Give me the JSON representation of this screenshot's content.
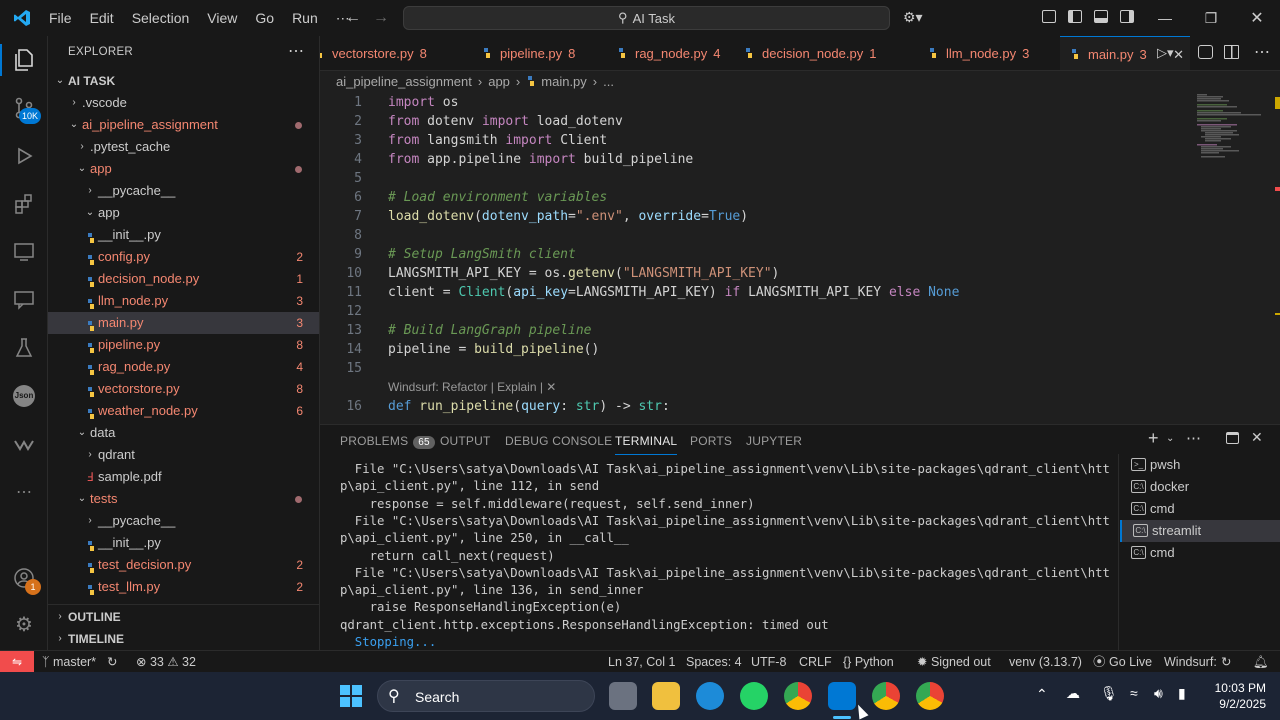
{
  "titlebar": {
    "menu": [
      "File",
      "Edit",
      "Selection",
      "View",
      "Go",
      "Run",
      "⋯"
    ],
    "search_text": "AI Task"
  },
  "activity": {
    "scm_badge": "10K",
    "account_badge": "1"
  },
  "explorer": {
    "header": "EXPLORER",
    "root": "AI TASK",
    "outline": "OUTLINE",
    "timeline": "TIMELINE",
    "rows": [
      {
        "label": ".vscode",
        "depth": 1,
        "kind": "folder-closed",
        "color": "norm",
        "count": ""
      },
      {
        "label": "ai_pipeline_assignment",
        "depth": 1,
        "kind": "folder-open",
        "color": "err",
        "count": "",
        "dot": true
      },
      {
        "label": ".pytest_cache",
        "depth": 2,
        "kind": "folder-closed",
        "color": "norm",
        "count": ""
      },
      {
        "label": "app",
        "depth": 2,
        "kind": "folder-open",
        "color": "err",
        "count": "",
        "dot": true
      },
      {
        "label": "__pycache__",
        "depth": 3,
        "kind": "folder-closed",
        "color": "norm",
        "count": ""
      },
      {
        "label": "app",
        "depth": 3,
        "kind": "folder-open",
        "color": "norm",
        "count": ""
      },
      {
        "label": "__init__.py",
        "depth": 3,
        "kind": "py",
        "color": "norm",
        "count": ""
      },
      {
        "label": "config.py",
        "depth": 3,
        "kind": "py",
        "color": "err",
        "count": "2"
      },
      {
        "label": "decision_node.py",
        "depth": 3,
        "kind": "py",
        "color": "err",
        "count": "1"
      },
      {
        "label": "llm_node.py",
        "depth": 3,
        "kind": "py",
        "color": "err",
        "count": "3"
      },
      {
        "label": "main.py",
        "depth": 3,
        "kind": "py",
        "color": "err",
        "count": "3",
        "selected": true
      },
      {
        "label": "pipeline.py",
        "depth": 3,
        "kind": "py",
        "color": "err",
        "count": "8"
      },
      {
        "label": "rag_node.py",
        "depth": 3,
        "kind": "py",
        "color": "err",
        "count": "4"
      },
      {
        "label": "vectorstore.py",
        "depth": 3,
        "kind": "py",
        "color": "err",
        "count": "8"
      },
      {
        "label": "weather_node.py",
        "depth": 3,
        "kind": "py",
        "color": "err",
        "count": "6"
      },
      {
        "label": "data",
        "depth": 2,
        "kind": "folder-open",
        "color": "norm",
        "count": ""
      },
      {
        "label": "qdrant",
        "depth": 3,
        "kind": "folder-closed",
        "color": "norm",
        "count": ""
      },
      {
        "label": "sample.pdf",
        "depth": 3,
        "kind": "pdf",
        "color": "norm",
        "count": ""
      },
      {
        "label": "tests",
        "depth": 2,
        "kind": "folder-open",
        "color": "err",
        "count": "",
        "dot": true
      },
      {
        "label": "__pycache__",
        "depth": 3,
        "kind": "folder-closed",
        "color": "norm",
        "count": ""
      },
      {
        "label": "__init__.py",
        "depth": 3,
        "kind": "py",
        "color": "norm",
        "count": ""
      },
      {
        "label": "test_decision.py",
        "depth": 3,
        "kind": "py",
        "color": "err",
        "count": "2"
      },
      {
        "label": "test_llm.py",
        "depth": 3,
        "kind": "py",
        "color": "err",
        "count": "2"
      }
    ]
  },
  "tabs": [
    {
      "name": "vectorstore.py",
      "count": "8"
    },
    {
      "name": "pipeline.py",
      "count": "8"
    },
    {
      "name": "rag_node.py",
      "count": "4"
    },
    {
      "name": "decision_node.py",
      "count": "1"
    },
    {
      "name": "llm_node.py",
      "count": "3"
    },
    {
      "name": "main.py",
      "count": "3",
      "active": true
    }
  ],
  "breadcrumb": [
    "ai_pipeline_assignment",
    "app",
    "main.py",
    "..."
  ],
  "codelens": "Windsurf: Refactor | Explain | ✕",
  "code_lines": [
    {
      "n": "1",
      "tokens": [
        [
          "kw",
          "import"
        ],
        [
          "pl",
          " os"
        ]
      ]
    },
    {
      "n": "2",
      "tokens": [
        [
          "kw",
          "from"
        ],
        [
          "pl",
          " dotenv "
        ],
        [
          "kw",
          "import"
        ],
        [
          "pl",
          " load_dotenv"
        ]
      ]
    },
    {
      "n": "3",
      "tokens": [
        [
          "kw",
          "from"
        ],
        [
          "pl",
          " langsmith "
        ],
        [
          "kw",
          "import"
        ],
        [
          "pl",
          " Client"
        ]
      ]
    },
    {
      "n": "4",
      "tokens": [
        [
          "kw",
          "from"
        ],
        [
          "pl",
          " app.pipeline "
        ],
        [
          "kw",
          "import"
        ],
        [
          "pl",
          " build_pipeline"
        ]
      ]
    },
    {
      "n": "5",
      "tokens": []
    },
    {
      "n": "6",
      "tokens": [
        [
          "cm",
          "# Load environment variables"
        ]
      ]
    },
    {
      "n": "7",
      "tokens": [
        [
          "fn",
          "load_dotenv"
        ],
        [
          "pl",
          "("
        ],
        [
          "var",
          "dotenv_path"
        ],
        [
          "pl",
          "="
        ],
        [
          "str",
          "\".env\""
        ],
        [
          "pl",
          ", "
        ],
        [
          "var",
          "override"
        ],
        [
          "pl",
          "="
        ],
        [
          "cn",
          "True"
        ],
        [
          "pl",
          ")"
        ]
      ]
    },
    {
      "n": "8",
      "tokens": []
    },
    {
      "n": "9",
      "tokens": [
        [
          "cm",
          "# Setup LangSmith client"
        ]
      ]
    },
    {
      "n": "10",
      "tokens": [
        [
          "pl",
          "LANGSMITH_API_KEY = os."
        ],
        [
          "fn",
          "getenv"
        ],
        [
          "pl",
          "("
        ],
        [
          "str",
          "\"LANGSMITH_API_KEY\""
        ],
        [
          "pl",
          ")"
        ]
      ]
    },
    {
      "n": "11",
      "tokens": [
        [
          "pl",
          "client = "
        ],
        [
          "bi",
          "Client"
        ],
        [
          "pl",
          "("
        ],
        [
          "var",
          "api_key"
        ],
        [
          "pl",
          "=LANGSMITH_API_KEY) "
        ],
        [
          "kw",
          "if"
        ],
        [
          "pl",
          " LANGSMITH_API_KEY "
        ],
        [
          "kw",
          "else"
        ],
        [
          "cn",
          " None"
        ]
      ]
    },
    {
      "n": "12",
      "tokens": []
    },
    {
      "n": "13",
      "tokens": [
        [
          "cm",
          "# Build LangGraph pipeline"
        ]
      ]
    },
    {
      "n": "14",
      "tokens": [
        [
          "pl",
          "pipeline = "
        ],
        [
          "fn",
          "build_pipeline"
        ],
        [
          "pl",
          "()"
        ]
      ]
    },
    {
      "n": "15",
      "tokens": []
    },
    {
      "n": "",
      "tokens": [],
      "codelens": true
    },
    {
      "n": "16",
      "tokens": [
        [
          "cn",
          "def"
        ],
        [
          "fn",
          " run_pipeline"
        ],
        [
          "pl",
          "("
        ],
        [
          "var",
          "query"
        ],
        [
          "pl",
          ": "
        ],
        [
          "bi",
          "str"
        ],
        [
          "pl",
          ") -> "
        ],
        [
          "bi",
          "str"
        ],
        [
          "pl",
          ":"
        ]
      ]
    }
  ],
  "panel": {
    "tabs": [
      "PROBLEMS",
      "OUTPUT",
      "DEBUG CONSOLE",
      "TERMINAL",
      "PORTS",
      "JUPYTER"
    ],
    "problems_count": "65",
    "active_tab": "TERMINAL",
    "terminal_lines": [
      "  File \"C:\\Users\\satya\\Downloads\\AI Task\\ai_pipeline_assignment\\venv\\Lib\\site-packages\\qdrant_client\\htt",
      "p\\api_client.py\", line 112, in send",
      "    response = self.middleware(request, self.send_inner)",
      "  File \"C:\\Users\\satya\\Downloads\\AI Task\\ai_pipeline_assignment\\venv\\Lib\\site-packages\\qdrant_client\\htt",
      "p\\api_client.py\", line 250, in __call__",
      "    return call_next(request)",
      "  File \"C:\\Users\\satya\\Downloads\\AI Task\\ai_pipeline_assignment\\venv\\Lib\\site-packages\\qdrant_client\\htt",
      "p\\api_client.py\", line 136, in send_inner",
      "    raise ResponseHandlingException(e)",
      "qdrant_client.http.exceptions.ResponseHandlingException: timed out",
      "  Stopping..."
    ],
    "terminals": [
      {
        "name": "pwsh",
        "icon": ">_"
      },
      {
        "name": "docker",
        "icon": "C:\\"
      },
      {
        "name": "cmd",
        "icon": "C:\\"
      },
      {
        "name": "streamlit",
        "icon": "C:\\",
        "active": true
      },
      {
        "name": "cmd",
        "icon": "C:\\"
      }
    ]
  },
  "status": {
    "branch": "master*",
    "errors": "33",
    "warnings": "32",
    "position": "Ln 37, Col 1",
    "spaces": "Spaces: 4",
    "encoding": "UTF-8",
    "eol": "CRLF",
    "language": "Python",
    "signed": "Signed out",
    "venv": "venv (3.13.7)",
    "golive": "Go Live",
    "windsurf": "Windsurf:"
  },
  "taskbar": {
    "search": "Search",
    "time": "10:03 PM",
    "date": "9/2/2025"
  },
  "colors": {
    "accent": "#0078d4",
    "error": "#f48771",
    "bg": "#1f1f1f",
    "sidebar": "#181818"
  }
}
